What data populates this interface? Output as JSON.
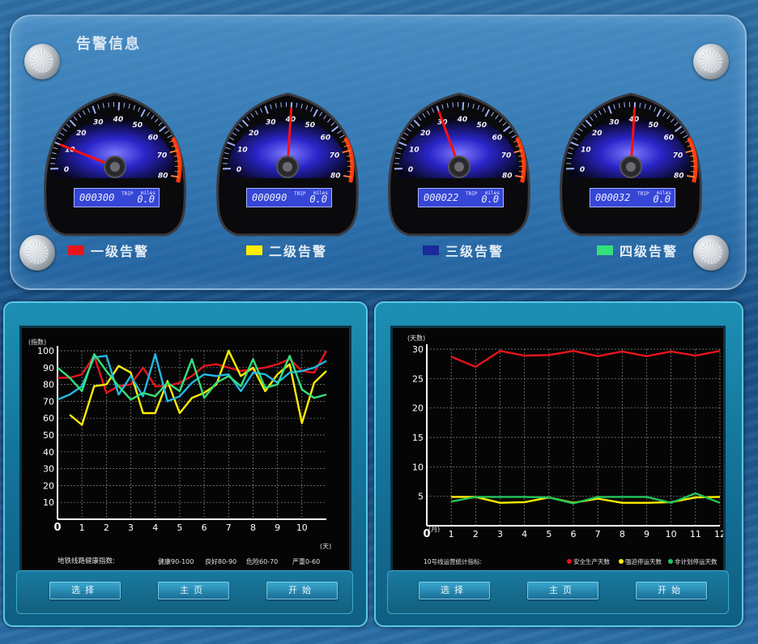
{
  "alarm": {
    "title": "告警信息",
    "gauges": [
      {
        "odometer": "000300",
        "value": 10,
        "trip": "TRIP",
        "miles": "miles",
        "small": "0.0"
      },
      {
        "odometer": "000090",
        "value": 40,
        "trip": "TRIP",
        "miles": "miles",
        "small": "0.0"
      },
      {
        "odometer": "000022",
        "value": 30,
        "trip": "TRIP",
        "miles": "miles",
        "small": "0.0"
      },
      {
        "odometer": "000032",
        "value": 40,
        "trip": "TRIP",
        "miles": "miles",
        "small": "0.0"
      }
    ],
    "gauge_ticks": [
      "0",
      "10",
      "20",
      "30",
      "40",
      "50",
      "60",
      "70",
      "80"
    ],
    "legend": [
      {
        "label": "一级告警",
        "color": "#e8141c"
      },
      {
        "label": "二级告警",
        "color": "#ffee00"
      },
      {
        "label": "三级告警",
        "color": "#1a2a9a"
      },
      {
        "label": "四级告警",
        "color": "#33e07a"
      }
    ]
  },
  "left_panel": {
    "footer_text": "地铁线路健康指数:",
    "ranges": [
      "健康90-100",
      "良好80-90",
      "危险60-70",
      "严重0-60"
    ],
    "buttons": {
      "select": "选择",
      "home": "主页",
      "start": "开始"
    }
  },
  "right_panel": {
    "footer_text": "10号线运营统计指标:",
    "buttons": {
      "select": "选择",
      "home": "主页",
      "start": "开始"
    }
  },
  "chart_data": [
    {
      "type": "line",
      "ylabel": "(指数)",
      "xlabel": "(天)",
      "x": [
        0,
        0.5,
        1,
        1.5,
        2,
        2.5,
        3,
        3.5,
        4,
        4.5,
        5,
        5.5,
        6,
        6.5,
        7,
        7.5,
        8,
        8.5,
        9,
        9.5,
        10,
        10.5,
        11
      ],
      "xticks": [
        "0",
        "1",
        "2",
        "3",
        "4",
        "5",
        "6",
        "7",
        "8",
        "9",
        "10"
      ],
      "yticks": [
        "0",
        "10",
        "20",
        "30",
        "40",
        "50",
        "60",
        "70",
        "80",
        "90",
        "100"
      ],
      "ylim": [
        0,
        100
      ],
      "series": [
        {
          "color": "#e8141c",
          "values": [
            84,
            84,
            86,
            97,
            75,
            79,
            80,
            90,
            79,
            79,
            81,
            85,
            91,
            92,
            90,
            88,
            89,
            90,
            92,
            95,
            88,
            87,
            100
          ]
        },
        {
          "color": "#ffee00",
          "values": [
            null,
            62,
            56,
            79,
            80,
            91,
            87,
            63,
            63,
            82,
            63,
            72,
            75,
            80,
            100,
            85,
            90,
            76,
            86,
            92,
            57,
            81,
            88
          ]
        },
        {
          "color": "#22b8e6",
          "values": [
            71,
            74,
            79,
            96,
            97,
            74,
            85,
            73,
            98,
            70,
            73,
            81,
            86,
            85,
            86,
            76,
            87,
            86,
            81,
            87,
            88,
            90,
            94
          ]
        },
        {
          "color": "#33e07a",
          "values": [
            90,
            84,
            76,
            98,
            88,
            79,
            71,
            75,
            73,
            81,
            76,
            95,
            72,
            81,
            85,
            79,
            95,
            78,
            80,
            97,
            77,
            72,
            74
          ]
        }
      ]
    },
    {
      "type": "line",
      "ylabel": "(天数)",
      "xlabel": "(月)",
      "x": [
        1,
        2,
        3,
        4,
        5,
        6,
        7,
        8,
        9,
        10,
        11,
        12
      ],
      "xticks": [
        "0",
        "1",
        "2",
        "3",
        "4",
        "5",
        "6",
        "7",
        "8",
        "9",
        "10",
        "11",
        "12"
      ],
      "yticks": [
        "0",
        "5",
        "10",
        "15",
        "20",
        "25",
        "30"
      ],
      "ylim": [
        0,
        30
      ],
      "legend": [
        "安全生产天数",
        "强迫停运天数",
        "非计划停运天数"
      ],
      "series": [
        {
          "name": "安全生产天数",
          "color": "#e8141c",
          "values": [
            28.7,
            27,
            29.7,
            28.9,
            29,
            29.7,
            28.8,
            29.6,
            28.8,
            29.6,
            28.9,
            29.7
          ]
        },
        {
          "name": "强迫停运天数",
          "color": "#ffee00",
          "values": [
            4.9,
            4.9,
            3.9,
            4,
            4.8,
            3.9,
            4.6,
            3.9,
            3.9,
            4,
            4.8,
            4.9
          ]
        },
        {
          "name": "非计划停运天数",
          "color": "#22c45a",
          "values": [
            4.1,
            4.9,
            4.9,
            4.9,
            4.8,
            3.8,
            4.9,
            4.9,
            4.9,
            3.9,
            5.5,
            3.9
          ]
        }
      ]
    }
  ]
}
